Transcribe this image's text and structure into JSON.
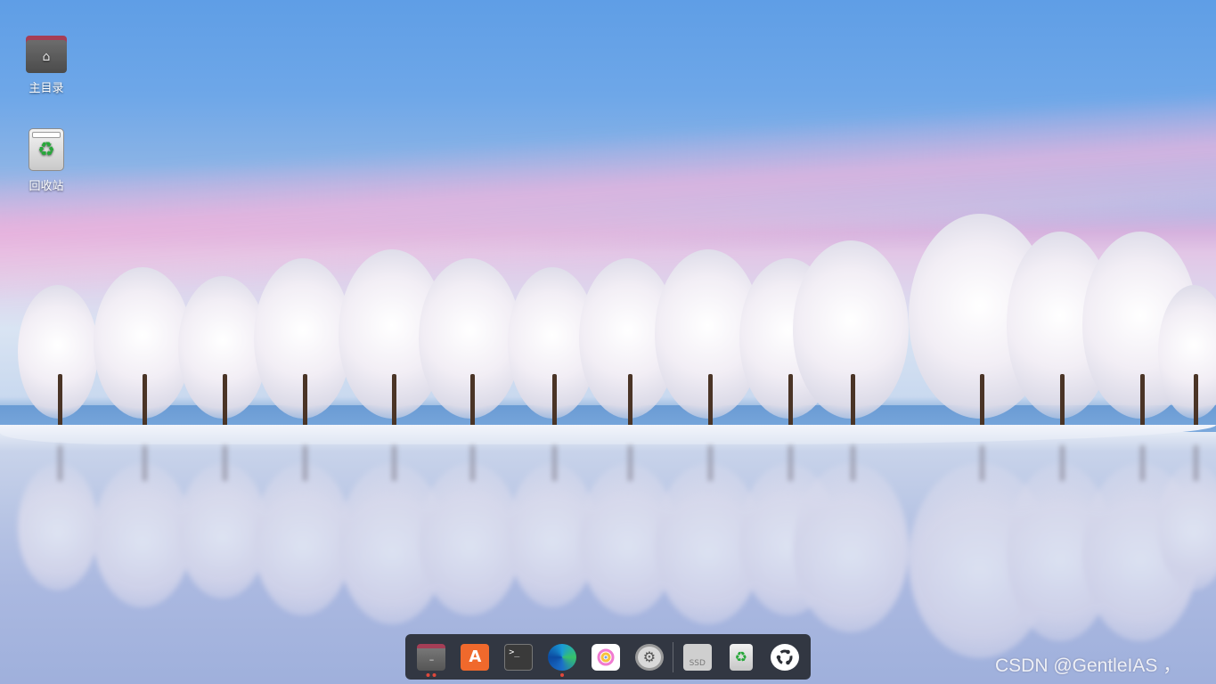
{
  "desktop_icons": [
    {
      "label": "主目录",
      "icon": "home-folder-icon"
    },
    {
      "label": "回收站",
      "icon": "trash-icon"
    }
  ],
  "dock": {
    "items": [
      {
        "name": "files",
        "icon": "files-icon",
        "running": true
      },
      {
        "name": "software-store",
        "icon": "store-icon",
        "running": false
      },
      {
        "name": "terminal",
        "icon": "terminal-icon",
        "running": false
      },
      {
        "name": "edge-browser",
        "icon": "edge-icon",
        "running": true
      },
      {
        "name": "paint",
        "icon": "paint-icon",
        "running": false
      },
      {
        "name": "settings",
        "icon": "gear-icon",
        "running": false
      },
      {
        "name": "ssd-drive",
        "icon": "ssd-icon",
        "label": "SSD",
        "running": false
      },
      {
        "name": "trash",
        "icon": "trash-icon",
        "running": false
      },
      {
        "name": "show-apps",
        "icon": "ubuntu-icon",
        "running": false
      }
    ]
  },
  "watermark": "CSDN @GentleIAS ，",
  "colors": {
    "dock_bg": "#282c34",
    "running_dot": "#e0483b",
    "folder_tab": "#a53e56"
  }
}
